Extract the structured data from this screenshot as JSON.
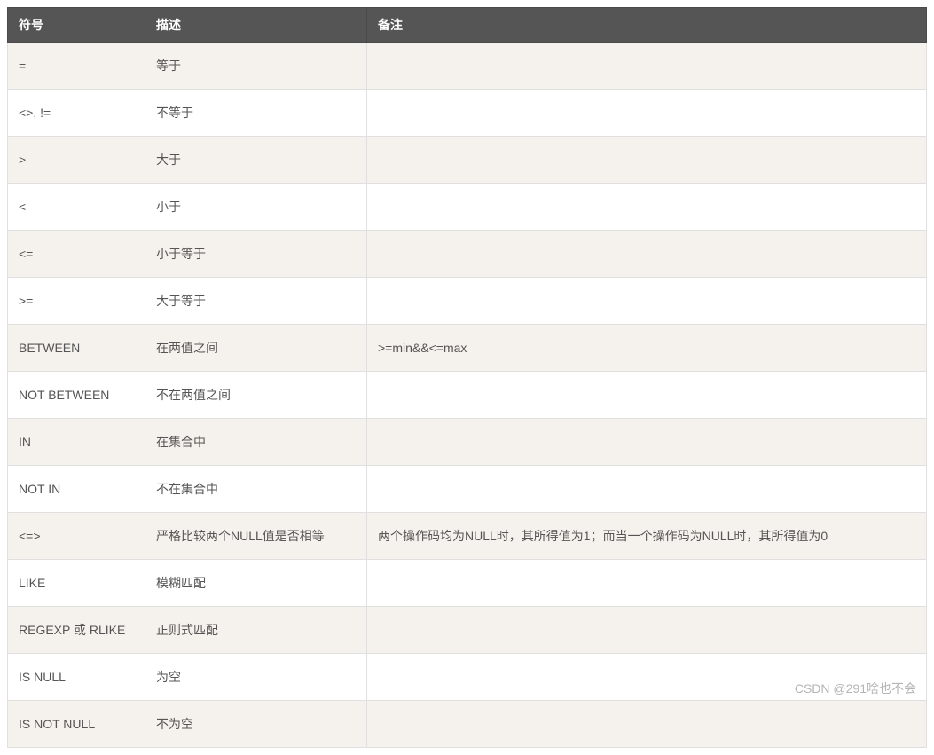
{
  "table": {
    "headers": [
      "符号",
      "描述",
      "备注"
    ],
    "rows": [
      {
        "symbol": "=",
        "desc": "等于",
        "note": ""
      },
      {
        "symbol": "<>, !=",
        "desc": "不等于",
        "note": ""
      },
      {
        "symbol": ">",
        "desc": "大于",
        "note": ""
      },
      {
        "symbol": "<",
        "desc": "小于",
        "note": ""
      },
      {
        "symbol": "<=",
        "desc": "小于等于",
        "note": ""
      },
      {
        "symbol": ">=",
        "desc": "大于等于",
        "note": ""
      },
      {
        "symbol": "BETWEEN",
        "desc": "在两值之间",
        "note": ">=min&&<=max"
      },
      {
        "symbol": "NOT BETWEEN",
        "desc": "不在两值之间",
        "note": ""
      },
      {
        "symbol": "IN",
        "desc": "在集合中",
        "note": ""
      },
      {
        "symbol": "NOT IN",
        "desc": "不在集合中",
        "note": ""
      },
      {
        "symbol": "<=>",
        "desc": "严格比较两个NULL值是否相等",
        "note": "两个操作码均为NULL时，其所得值为1；而当一个操作码为NULL时，其所得值为0"
      },
      {
        "symbol": "LIKE",
        "desc": "模糊匹配",
        "note": ""
      },
      {
        "symbol": "REGEXP 或 RLIKE",
        "desc": "正则式匹配",
        "note": ""
      },
      {
        "symbol": "IS NULL",
        "desc": "为空",
        "note": ""
      },
      {
        "symbol": "IS NOT NULL",
        "desc": "不为空",
        "note": ""
      }
    ]
  },
  "watermark": "CSDN @291啥也不会"
}
